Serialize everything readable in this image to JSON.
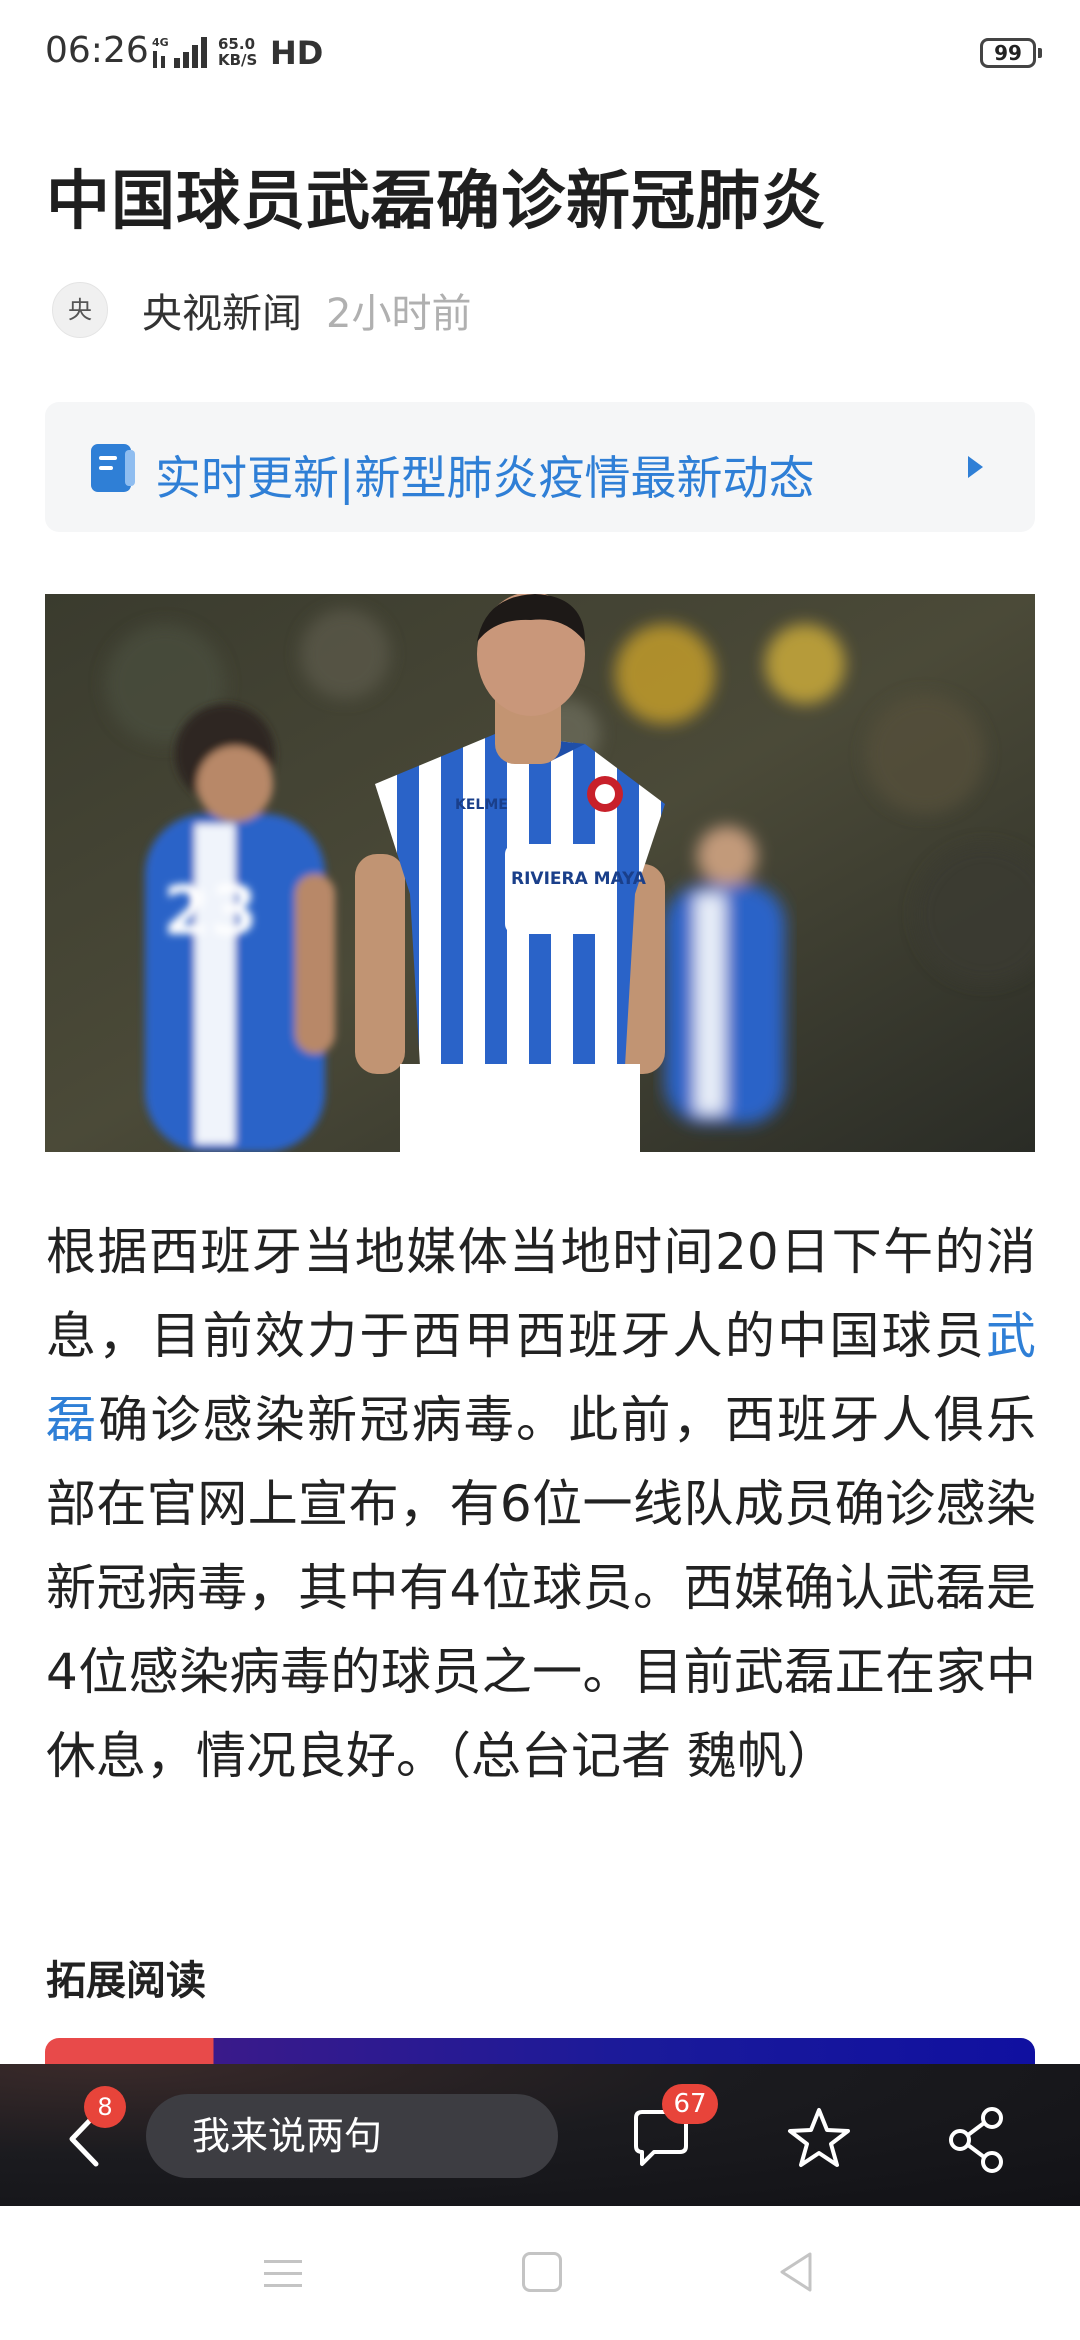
{
  "status_bar": {
    "time": "06:26",
    "network": "4G",
    "speed_value": "65.0",
    "speed_unit": "KB/S",
    "hd": "HD",
    "battery": "99"
  },
  "article": {
    "title": "中国球员武磊确诊新冠肺炎",
    "source_avatar_char": "央",
    "source_name": "央视新闻",
    "publish_time": "2小时前",
    "live_banner_text": "实时更新|新型肺炎疫情最新动态",
    "photo": {
      "player_name_on_shirt": "RIVIERA MAYA",
      "shirt_brand": "KELME",
      "background_player_number": "23"
    },
    "body": {
      "part1": "根据西班牙当地媒体当地时间20日下午的消息，目前效力于西甲西班牙人的中国球员",
      "link": "武磊",
      "part2": "确诊感染新冠病毒。此前，西班牙人俱乐部在官网上宣布，有6位一线队成员确诊感染新冠病毒，其中有4位球员。西媒确认武磊是4位感染病毒的球员之一。目前武磊正在家中休息，情况良好。（总台记者 魏帆）"
    },
    "related_heading": "拓展阅读"
  },
  "action_bar": {
    "back_badge": "8",
    "comment_placeholder": "我来说两句",
    "comment_count": "67"
  },
  "colors": {
    "link": "#2f7fd6",
    "badge": "#e8443a",
    "bar_bg": "#1b1b1f"
  },
  "icons": {
    "live": "document-icon",
    "back": "chevron-left-icon",
    "comment": "speech-bubble-icon",
    "favorite": "star-icon",
    "share": "share-icon"
  }
}
